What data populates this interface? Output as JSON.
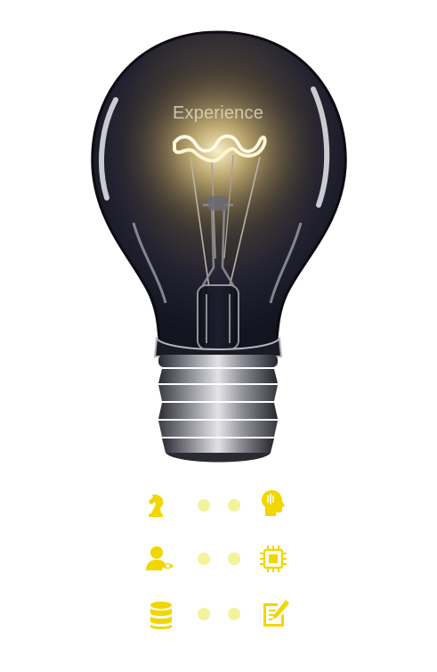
{
  "bulb": {
    "label": "Experience",
    "glow_color": "#f5d98a"
  },
  "accent_color": "#f2d600",
  "dot_color": "#f3f39a",
  "rows": [
    {
      "left_icon": "chess-knight-icon",
      "right_icon": "head-profile-icon"
    },
    {
      "left_icon": "user-eye-icon",
      "right_icon": "cpu-chip-icon"
    },
    {
      "left_icon": "database-icon",
      "right_icon": "edit-document-icon"
    }
  ]
}
